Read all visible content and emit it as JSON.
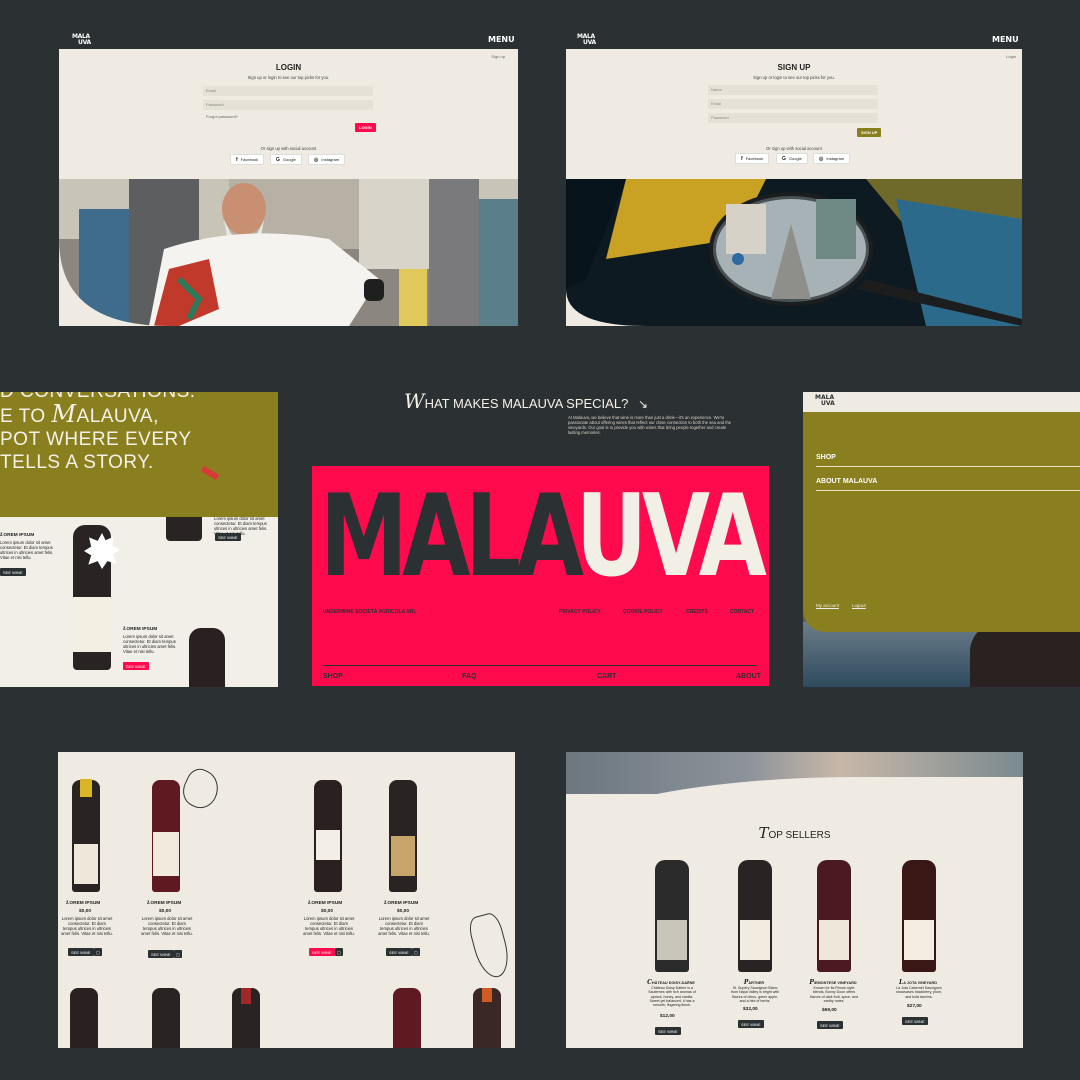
{
  "brand": {
    "logo_line1": "MALA",
    "logo_line2": "UVA",
    "menu": "MENU"
  },
  "login": {
    "corner_link": "Sign up",
    "title": "LOGIN",
    "subtitle": "Sign up or login to see our top picks for you.",
    "email_placeholder": "Email",
    "password_placeholder": "Password",
    "forgot": "Forgot password?",
    "button": "LOGIN",
    "social_label": "Or sign up with social account",
    "social": [
      "Facebook",
      "Google",
      "Instagram"
    ]
  },
  "signup": {
    "corner_link": "Login",
    "title": "SIGN UP",
    "subtitle": "Sign up or login to see our top picks for you.",
    "name_placeholder": "Name",
    "email_placeholder": "Email",
    "password_placeholder": "Password",
    "button": "SIGN UP",
    "social_label": "Or sign up with social account",
    "social": [
      "Facebook",
      "Google",
      "Instagram"
    ]
  },
  "welcome": {
    "line1": "D CONVERSATIONS.",
    "line2_pre": "E TO ",
    "line2_cap": "M",
    "line2_rest": "ALAUVA,",
    "line3": "POT WHERE EVERY",
    "line4": "TELLS A STORY.",
    "item_name": "OREM IPSUM",
    "item_cap": "L",
    "lorem": "Lorem ipsum dolor sit amet consectetur. Et diam tempus ultrices in ultricies amet felis. Vitae et nisi tellu.",
    "see_wine": "SEE WINE"
  },
  "special": {
    "cap": "W",
    "title": "HAT MAKES MALAUVA SPECIAL?",
    "body": "At Malauva, we believe that wine is more than just a drink—it's an experience. We're passionate about offering wines that reflect our close connection to both the sea and the vineyards. Our goal is to provide you with wines that bring people together and create lasting memories."
  },
  "footer": {
    "word_dark": "MALA",
    "word_light": "UVA",
    "company": "UNDERWINE SOCIETÀ AGRICOLA SRL",
    "legal": [
      "PRIVACY POLICY",
      "COOKIE POLICY",
      "CREDITS",
      "CONTACT"
    ],
    "nav": [
      "SHOP",
      "FAQ",
      "CART",
      "ABOUT"
    ]
  },
  "menu_panel": {
    "items": [
      "SHOP",
      "ABOUT MALAUVA"
    ],
    "account": "My account",
    "logout": "Logout"
  },
  "shop": {
    "cap": "L",
    "name": "OREM IPSUM",
    "price": "$0,00",
    "lorem": "Lorem ipsum dolor sit amet consectetur. Et diam tempus ultrices in ultricies amet felis. Vitae et nisi tellu.",
    "see_wine": "SEE WINE",
    "cart_icon": "cart-icon"
  },
  "top_sellers": {
    "cap": "T",
    "title": "OP SELLERS",
    "see_wine": "SEE WINE",
    "products": [
      {
        "cap": "C",
        "name": "HÂTEAU DOISY-DAËNE",
        "desc": "Château Doisy Daëne is a Sauternes with rich aromas of apricot, honey, and vanilla. Sweet yet balanced, it has a smooth, lingering finish.",
        "price": "$12,00"
      },
      {
        "cap": "P",
        "name": "ARTNER",
        "desc": "St. Supéry Sauvignon Blanc from Napa Valley is bright with flavors of citrus, green apple, and a hint of herbs.",
        "price": "$32,00"
      },
      {
        "cap": "P",
        "name": "IEMONTESE VINEYARD",
        "desc": "Known for its Rhone-style blends, Bonny Doon offers flavors of dark fruit, spice, and earthy notes.",
        "price": "$69,00"
      },
      {
        "cap": "L",
        "name": "A JOTA VINEYARD",
        "desc": "La Jota Cabernet Sauvignon showcases blackberry, plum, and bold tannins.",
        "price": "$27,00"
      }
    ]
  },
  "colors": {
    "bg": "#2b3033",
    "cream": "#efebe2",
    "red": "#ff0a4c",
    "olive": "#8a7f1e",
    "dark": "#2b3033"
  }
}
